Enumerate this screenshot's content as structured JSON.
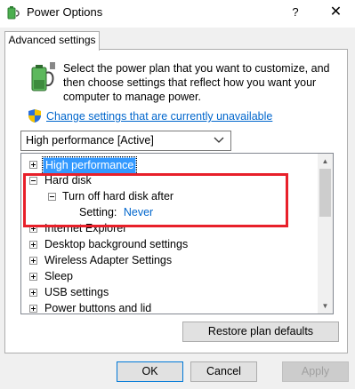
{
  "window": {
    "title": "Power Options",
    "help_label": "?",
    "close_label": "✕"
  },
  "tabs": [
    {
      "label": "Advanced settings"
    }
  ],
  "description": "Select the power plan that you want to customize, and then choose settings that reflect how you want your computer to manage power.",
  "change_link": "Change settings that are currently unavailable",
  "plan_select": {
    "value": "High performance [Active]"
  },
  "tree": {
    "items": [
      {
        "label": "High performance",
        "state": "collapsed",
        "selected": true
      },
      {
        "label": "Hard disk",
        "state": "expanded"
      },
      {
        "label": "Turn off hard disk after",
        "state": "expanded"
      },
      {
        "setting_label": "Setting:",
        "setting_value": "Never"
      },
      {
        "label": "Internet Explorer",
        "state": "collapsed"
      },
      {
        "label": "Desktop background settings",
        "state": "collapsed"
      },
      {
        "label": "Wireless Adapter Settings",
        "state": "collapsed"
      },
      {
        "label": "Sleep",
        "state": "collapsed"
      },
      {
        "label": "USB settings",
        "state": "collapsed"
      },
      {
        "label": "Power buttons and lid",
        "state": "collapsed"
      }
    ]
  },
  "buttons": {
    "restore": "Restore plan defaults",
    "ok": "OK",
    "cancel": "Cancel",
    "apply": "Apply"
  },
  "colors": {
    "highlight_box": "#e8202a",
    "link": "#0066cc",
    "selection": "#3399ff"
  }
}
